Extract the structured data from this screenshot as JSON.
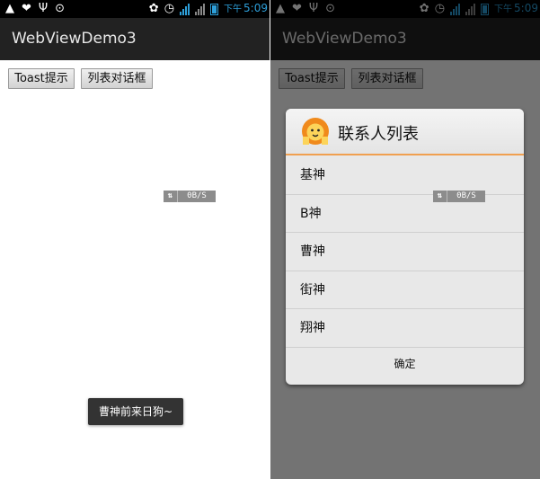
{
  "status_bar": {
    "left_icons": [
      "warning-icon",
      "shield-icon",
      "usb-icon",
      "download-icon"
    ],
    "right_icons": [
      "alarm-icon",
      "clock-icon",
      "signal-3g-icon",
      "signal-icon",
      "battery-icon"
    ],
    "signal_label": "3G",
    "time_prefix": "下午",
    "time": "5:09"
  },
  "app": {
    "title": "WebViewDemo3",
    "toast_button_label": "Toast提示",
    "list_dialog_button_label": "列表对话框"
  },
  "net_badge": {
    "icon": "transfer-arrows-icon",
    "arrows": "⇅",
    "value": "0B/S"
  },
  "toast": {
    "message": "曹神前来日狗~"
  },
  "dialog": {
    "icon": "lion-icon",
    "title": "联系人列表",
    "items": [
      "基神",
      "B神",
      "曹神",
      "街神",
      "翔神"
    ],
    "confirm_label": "确定"
  },
  "colors": {
    "accent_blue": "#2d9fd9",
    "action_bar": "#222222",
    "dialog_divider": "#f0a050",
    "toast_bg": "#333333"
  }
}
